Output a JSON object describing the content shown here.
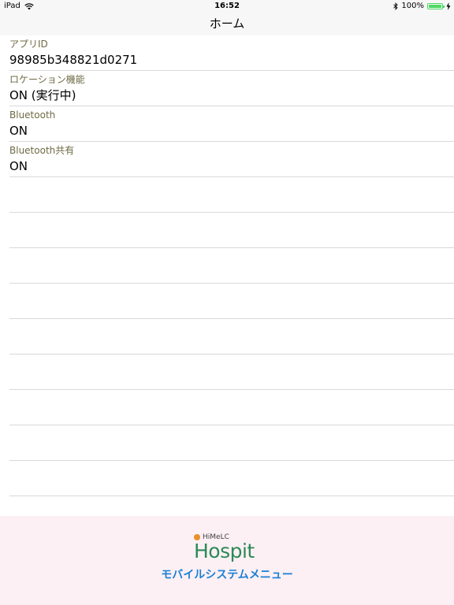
{
  "status_bar": {
    "device": "iPad",
    "time": "16:52",
    "battery_percent": "100%",
    "battery_level": 1.0,
    "wifi_icon": "wifi-icon",
    "bluetooth_icon": "bluetooth-icon",
    "charging_icon": "charging-icon"
  },
  "nav": {
    "title": "ホーム"
  },
  "rows": [
    {
      "label": "アプリID",
      "value": "98985b348821d0271"
    },
    {
      "label": "ロケーション機能",
      "value": "ON (実行中)"
    },
    {
      "label": "Bluetooth",
      "value": "ON"
    },
    {
      "label": "Bluetooth共有",
      "value": "ON"
    }
  ],
  "empty_rows": 9,
  "footer": {
    "logo_brand": "HiMeLC",
    "logo_name": "Hospit",
    "menu_link": "モバイルシステムメニュー"
  },
  "colors": {
    "label": "#6e6a43",
    "accent_link": "#1a7fd6",
    "logo_green": "#2b8a57",
    "footer_bg": "#fdf0f4",
    "battery_green": "#4cd964"
  }
}
